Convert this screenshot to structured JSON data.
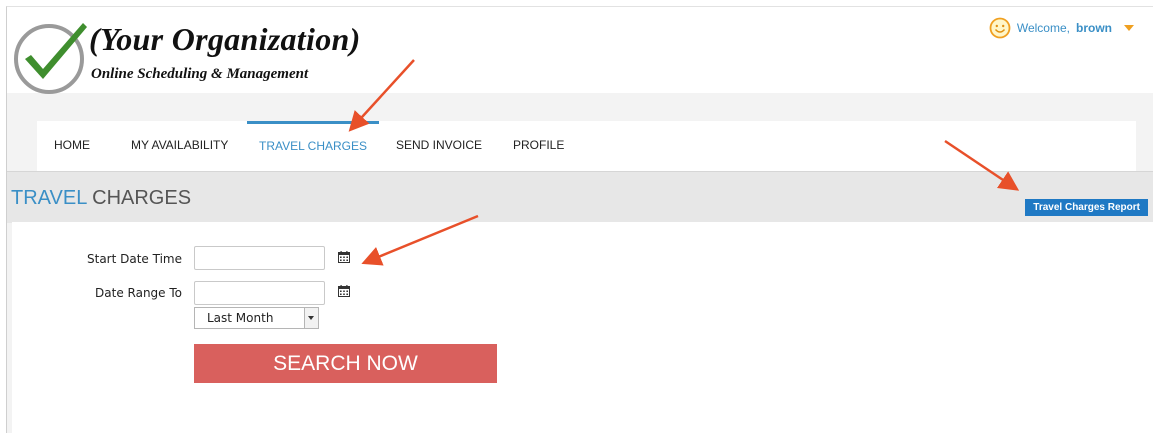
{
  "header": {
    "org_name": "(Your Organization)",
    "org_subtitle": "Online Scheduling & Management",
    "logo_icon": "checkmark-logo-icon",
    "welcome_prefix": "Welcome,",
    "username": "brown",
    "user_icon": "smiley-face-icon",
    "menu_icon": "caret-down-icon"
  },
  "nav": {
    "items": [
      {
        "label": "HOME"
      },
      {
        "label": "MY AVAILABILITY"
      },
      {
        "label": "TRAVEL CHARGES",
        "active": true
      },
      {
        "label": "SEND INVOICE"
      },
      {
        "label": "PROFILE"
      }
    ]
  },
  "page": {
    "title_accent": "TRAVEL",
    "title_rest": " CHARGES",
    "report_button": "Travel Charges Report"
  },
  "form": {
    "start_label": "Start Date Time",
    "start_value": "",
    "range_label": "Date Range To",
    "range_value": "",
    "calendar_icon": "calendar-icon",
    "period_selected": "Last Month",
    "search_button": "SEARCH NOW"
  },
  "colors": {
    "accent_blue": "#3a8fc6",
    "report_button_bg": "#1f79c4",
    "search_button_bg": "#d9605d",
    "annotation_arrow": "#e8502a",
    "logo_green": "#3f8e2e"
  }
}
